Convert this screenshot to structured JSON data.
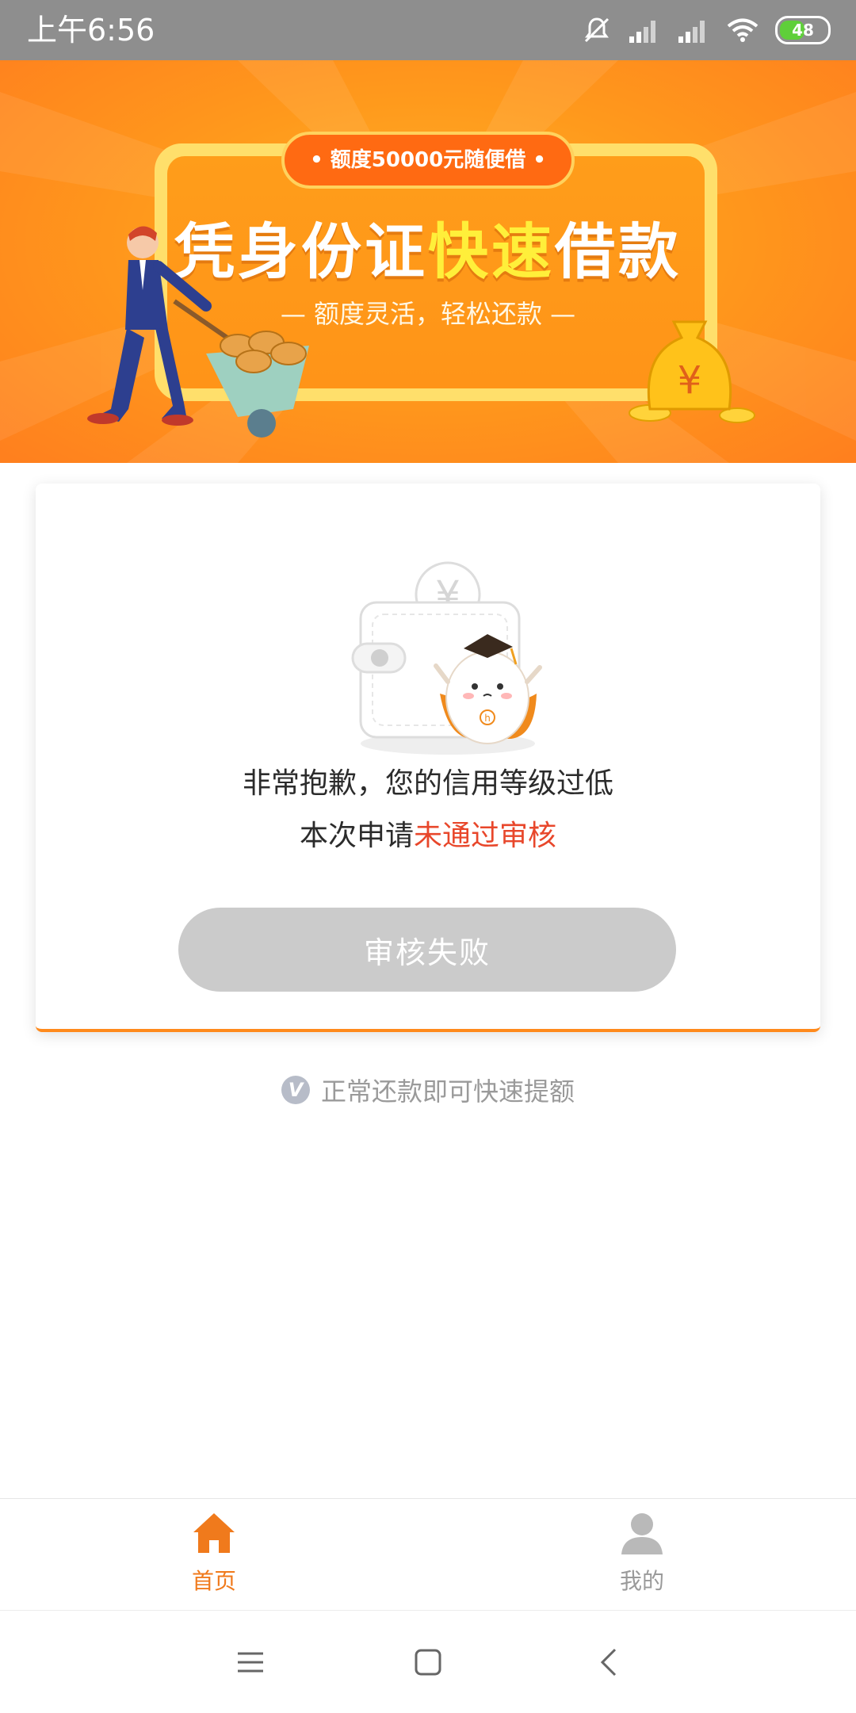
{
  "status_bar": {
    "time": "上午6:56",
    "battery_level": "48",
    "icons": [
      "mute-icon",
      "signal-icon",
      "signal-icon",
      "wifi-icon",
      "battery-icon"
    ]
  },
  "banner": {
    "pill_text": "• 额度50000元随便借 •",
    "title_part1": "凭身份证",
    "title_highlight": "快速",
    "title_part2": "借款",
    "subtitle": "— 额度灵活，轻松还款 —",
    "colors": {
      "primary": "#ff9a1c",
      "highlight": "#ffef3a"
    }
  },
  "result_card": {
    "message_line1": "非常抱歉，您的信用等级过低",
    "message_line2_prefix": "本次申请",
    "message_line2_red": "未通过审核",
    "button_label": "审核失败",
    "accent_color": "#ff8a1c",
    "error_color": "#e8472b"
  },
  "tip": {
    "icon_letter": "V",
    "text": "正常还款即可快速提额"
  },
  "bottom_nav": {
    "items": [
      {
        "label": "首页",
        "icon": "home-icon",
        "active": true
      },
      {
        "label": "我的",
        "icon": "user-icon",
        "active": false
      }
    ]
  },
  "system_nav": [
    "menu-icon",
    "home-square-icon",
    "back-icon"
  ]
}
